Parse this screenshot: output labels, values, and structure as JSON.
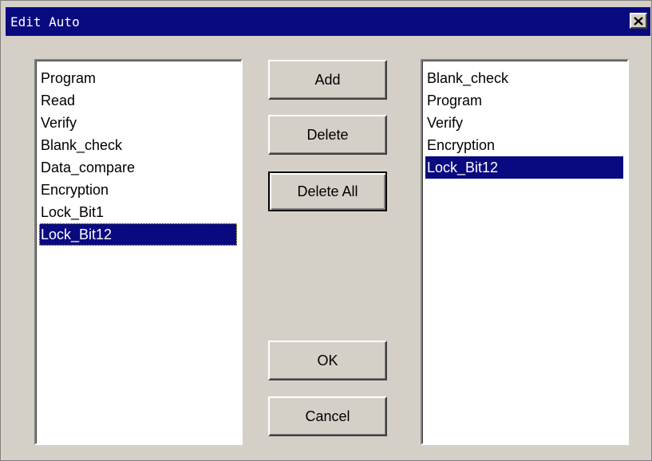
{
  "window": {
    "title": "Edit Auto",
    "close_glyph": "✕"
  },
  "available_list": {
    "items": [
      "Program",
      "Read",
      "Verify",
      "Blank_check",
      "Data_compare",
      "Encryption",
      "Lock_Bit1",
      "Lock_Bit12"
    ],
    "selected": "Lock_Bit12"
  },
  "selected_list": {
    "items": [
      "Blank_check",
      "Program",
      "Verify",
      "Encryption",
      "Lock_Bit12"
    ],
    "selected": "Lock_Bit12"
  },
  "buttons": {
    "add": "Add",
    "delete": "Delete",
    "delete_all": "Delete All",
    "ok": "OK",
    "cancel": "Cancel"
  },
  "colors": {
    "titlebar": "#0a0a80",
    "dialog_face": "#d4d0c8",
    "selection": "#0a0a80"
  }
}
